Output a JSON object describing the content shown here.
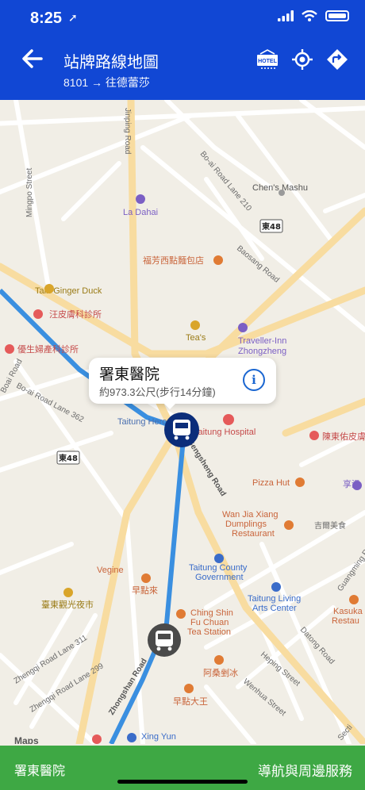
{
  "status_bar": {
    "time": "8:25",
    "location_arrow": "➚"
  },
  "header": {
    "title": "站牌路線地圖",
    "subtitle": "8101 → 往德蕾莎",
    "icons": [
      "back-arrow-icon",
      "hotel-icon",
      "locate-me-icon",
      "directions-icon"
    ],
    "hotel_text": "HOTEL"
  },
  "map": {
    "labels": {
      "jinping_road": "Jinping Road",
      "zhongshan_road_top": "Zhongshan Road",
      "mingpo_street": "Mingpo Street",
      "boai_lane_210": "Bo-ai Road Lane 210",
      "chens_mashu": "Chen's Mashu",
      "la_dahai": "La Dahai",
      "route48_1": "東48",
      "route48_2": "東48",
      "fangfang_bakery": "福芳西點麵包店",
      "baosang_road": "Baosang Road",
      "tain_ginger_duck": "Tain Ginger Duck",
      "wang_clinic": "汪皮膚科診所",
      "teas": "Tea's",
      "traveller_inn": "Traveller-Inn",
      "zhongzheng": "Zhongzheng",
      "youshi_clinic": "優生婦產科診所",
      "boai_road": "Boai Road",
      "boai_lane_362": "Bo-ai Road Lane 362",
      "taitung_hero_house": "Taitung Hero House",
      "taitung_hospital": "Taitung Hospital",
      "chendong_clinic": "陳東佑皮膚",
      "gengsheng_road": "Gengsheng Road",
      "pizza_hut": "Pizza Hut",
      "xiangwen": "享溫",
      "wan_jia_xiang": "Wan Jia Xiang",
      "dumplings": "Dumplings",
      "restaurant": "Restaurant",
      "jixiang_food": "吉爾美食",
      "vegine": "Vegine",
      "zaodian_lai": "早點來",
      "taitung_county": "Taitung County",
      "government": "Government",
      "guangming_road": "Guangming Road",
      "taitung_living": "Taitung Living",
      "arts_center": "Arts Center",
      "taitung_night_market": "臺東觀光夜市",
      "ching_shin": "Ching Shin",
      "fu_chuan": "Fu Chuan",
      "tea_station": "Tea Station",
      "kasuka": "Kasuka",
      "kasuka_rest": "Restau",
      "zhengqi_lane_311": "Zhengqi Road Lane 311",
      "zhengqi_lane_299": "Zhengqi Road Lane 299",
      "zhongshan_road_bottom": "Zhongshan Road",
      "asang_ice": "阿桑剉冰",
      "zaodian_dawang": "早點大王",
      "heping_street": "Heping Street",
      "wenhua_street": "Wenhua Street",
      "datong_road": "Datong Road",
      "xing_yun": "Xing Yun",
      "maps_logo": "Maps",
      "section": "Secti"
    },
    "route_color": "#3a8fe0",
    "callout": {
      "name": "署東醫院",
      "distance": "約973.3公尺(步行14分鐘)"
    }
  },
  "bottom_bar": {
    "stop_name": "署東醫院",
    "service_link": "導航與周邊服務"
  },
  "colors": {
    "header": "#1147d4",
    "bottom_bar": "#3ea844",
    "bus_marker": "#0b2d7a"
  }
}
